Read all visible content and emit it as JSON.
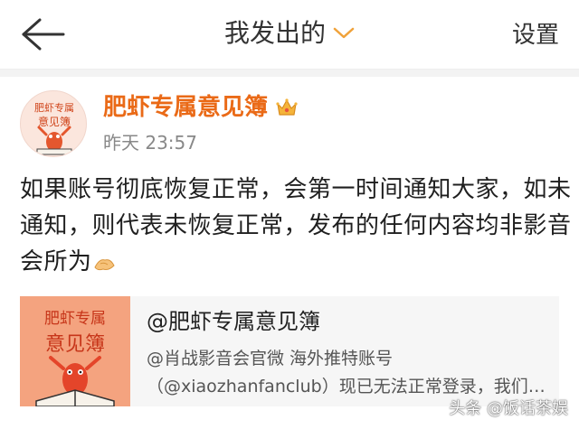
{
  "header": {
    "title": "我发出的",
    "settings_label": "设置"
  },
  "post": {
    "author": "肥虾专属意见簿",
    "time": "昨天 23:57",
    "text": "如果账号彻底恢复正常，会第一时间通知大家，如未通知，则代表未恢复正常，发布的任何内容均非影音会所为",
    "avatar_text_top": "肥虾专属",
    "avatar_text_bottom": "意见簿"
  },
  "card": {
    "title": "@肥虾专属意见簿",
    "description": "@肖战影音会官微 海外推特账号（@xiaozhanfanclub）现已无法正常登录，我们…",
    "image_text_top": "肥虾专属",
    "image_text_bottom": "意见簿"
  },
  "watermark": "头条 @饭话茶娱",
  "colors": {
    "accent": "#ea6a17",
    "chevron": "#f0a23a"
  }
}
